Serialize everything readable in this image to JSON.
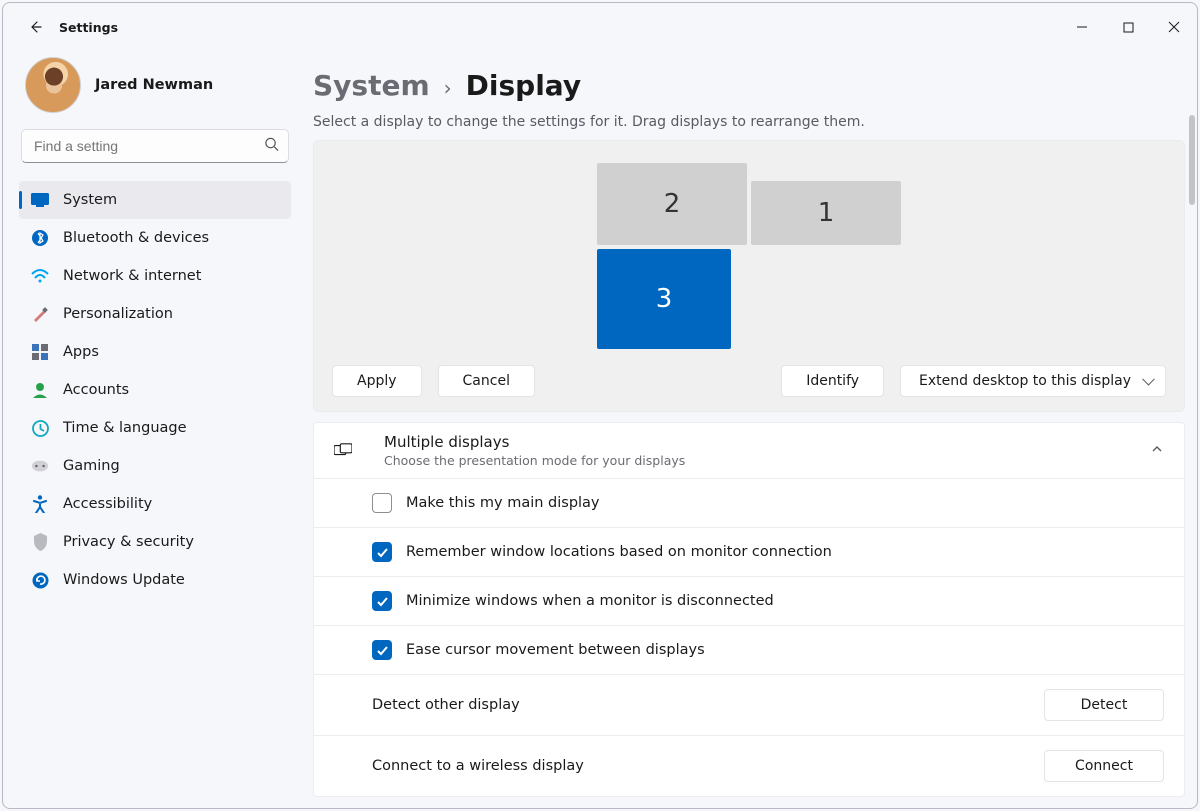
{
  "window": {
    "title": "Settings"
  },
  "user": {
    "name": "Jared Newman"
  },
  "search": {
    "placeholder": "Find a setting"
  },
  "sidebar": {
    "items": [
      {
        "label": "System"
      },
      {
        "label": "Bluetooth & devices"
      },
      {
        "label": "Network & internet"
      },
      {
        "label": "Personalization"
      },
      {
        "label": "Apps"
      },
      {
        "label": "Accounts"
      },
      {
        "label": "Time & language"
      },
      {
        "label": "Gaming"
      },
      {
        "label": "Accessibility"
      },
      {
        "label": "Privacy & security"
      },
      {
        "label": "Windows Update"
      }
    ]
  },
  "breadcrumb": {
    "parent": "System",
    "current": "Display"
  },
  "subtitle": "Select a display to change the settings for it. Drag displays to rearrange them.",
  "monitors": {
    "d1": "1",
    "d2": "2",
    "d3": "3",
    "selected": "3"
  },
  "buttons": {
    "apply": "Apply",
    "cancel": "Cancel",
    "identify": "Identify",
    "mode": "Extend desktop to this display"
  },
  "multi": {
    "title": "Multiple displays",
    "desc": "Choose the presentation mode for your displays",
    "opt_main": "Make this my main display",
    "opt_remember": "Remember window locations based on monitor connection",
    "opt_minimize": "Minimize windows when a monitor is disconnected",
    "opt_ease": "Ease cursor movement between displays",
    "detect_label": "Detect other display",
    "detect_btn": "Detect",
    "wireless_label": "Connect to a wireless display",
    "wireless_btn": "Connect"
  }
}
